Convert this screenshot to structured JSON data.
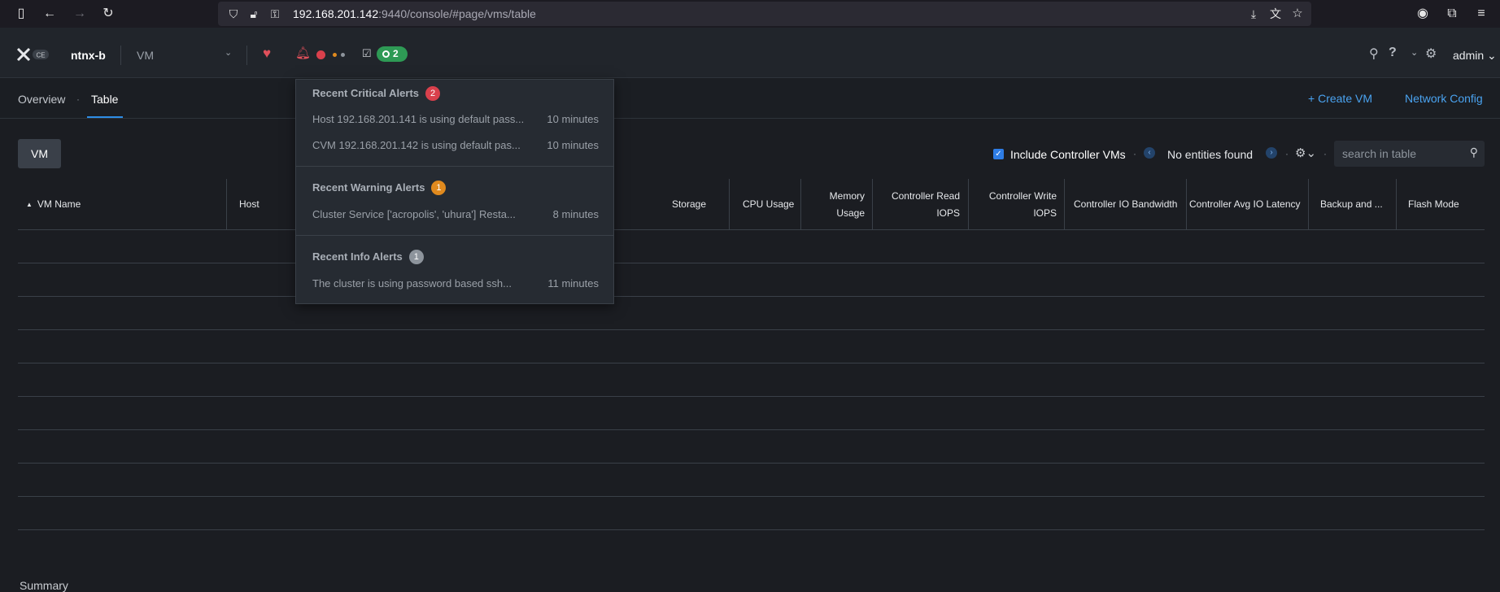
{
  "browser": {
    "url_host": "192.168.201.142",
    "url_path": ":9440/console/#page/vms/table"
  },
  "header": {
    "cluster_name": "ntnx-b",
    "entity_selector": "VM",
    "tasks_count": "2",
    "user": "admin",
    "logo_badge": "CE",
    "icons": [
      "nutanix-logo",
      "health-heart-icon",
      "alert-bell-icon",
      "tasks-icon",
      "search-icon",
      "help-icon",
      "settings-gear-icon"
    ]
  },
  "subnav": {
    "tabs": [
      {
        "label": "Overview",
        "active": false
      },
      {
        "label": "Table",
        "active": true
      }
    ],
    "create_vm": "Create VM",
    "network_config": "Network Config"
  },
  "toolbar": {
    "vm_button": "VM",
    "include_cvms_label": "Include Controller VMs",
    "include_cvms_checked": true,
    "pagination": "No entities found",
    "search_placeholder": "search in table"
  },
  "table": {
    "columns": [
      {
        "label": "VM Name"
      },
      {
        "label": "Host"
      },
      {
        "label": "Storage"
      },
      {
        "label": "CPU Usage"
      },
      {
        "label": "Memory",
        "label2": "Usage"
      },
      {
        "label": "Controller Read",
        "label2": "IOPS"
      },
      {
        "label": "Controller Write",
        "label2": "IOPS"
      },
      {
        "label": "Controller IO Bandwidth"
      },
      {
        "label": "Controller Avg IO Latency"
      },
      {
        "label": "Backup and ..."
      },
      {
        "label": "Flash Mode"
      }
    ],
    "summary_label": "Summary"
  },
  "alerts_popover": {
    "critical": {
      "title": "Recent Critical Alerts",
      "count": "2",
      "color": "#d9404c",
      "items": [
        {
          "message": "Host 192.168.201.141 is using default pass...",
          "time": "10 minutes"
        },
        {
          "message": "CVM 192.168.201.142 is using default pas...",
          "time": "10 minutes"
        }
      ]
    },
    "warning": {
      "title": "Recent Warning Alerts",
      "count": "1",
      "color": "#e08a1e",
      "items": [
        {
          "message": "Cluster Service ['acropolis', 'uhura'] Resta...",
          "time": "8 minutes"
        }
      ]
    },
    "info": {
      "title": "Recent Info Alerts",
      "count": "1",
      "color": "#8d949c",
      "items": [
        {
          "message": "The cluster is using password based ssh...",
          "time": "11 minutes"
        }
      ]
    }
  }
}
